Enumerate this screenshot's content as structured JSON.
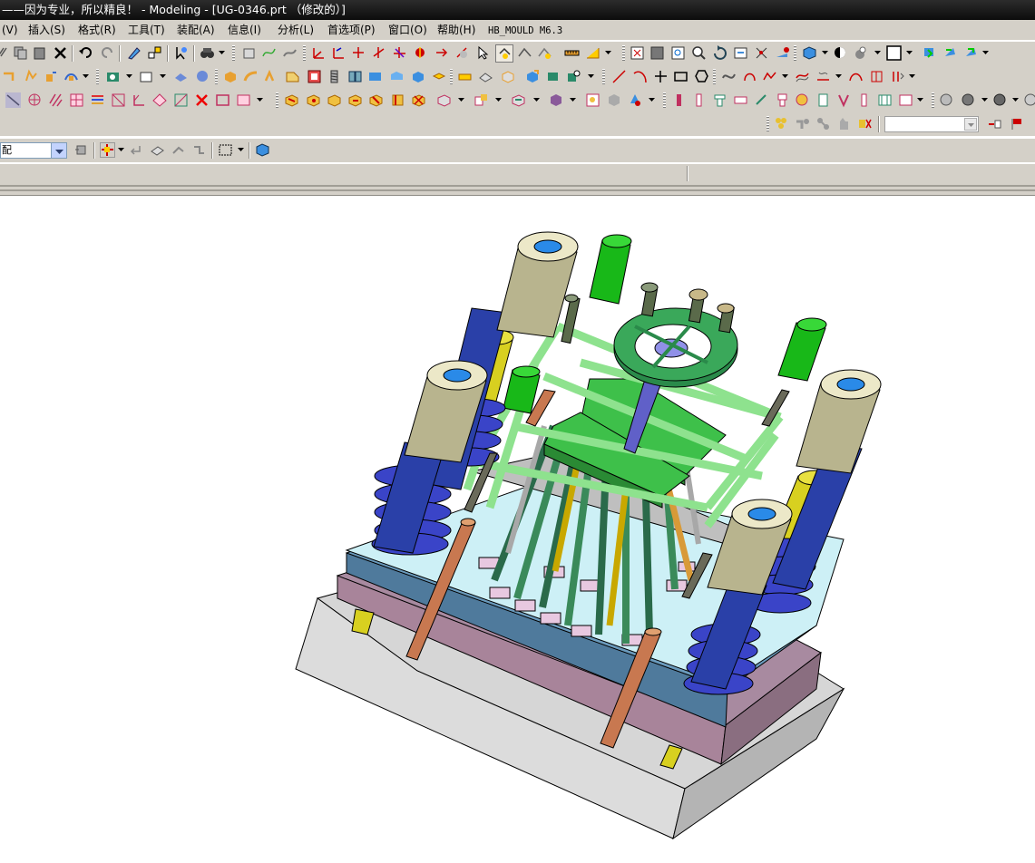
{
  "window": {
    "title": "——因为专业，所以精良！ - Modeling - [UG-0346.prt （修改的）]"
  },
  "menu": {
    "items": [
      {
        "key": "view",
        "label": "(V)"
      },
      {
        "key": "insert",
        "label": "插入(S)"
      },
      {
        "key": "format",
        "label": "格式(R)"
      },
      {
        "key": "tools",
        "label": "工具(T)"
      },
      {
        "key": "assembly",
        "label": "装配(A)"
      },
      {
        "key": "info",
        "label": "信息(I)"
      },
      {
        "key": "analysis",
        "label": "分析(L)"
      },
      {
        "key": "preferences",
        "label": "首选项(P)"
      },
      {
        "key": "window",
        "label": "窗口(O)"
      },
      {
        "key": "help",
        "label": "帮助(H)"
      },
      {
        "key": "hb-mould",
        "label": "HB_MOULD M6.3"
      }
    ]
  },
  "selection": {
    "filter_value": "配"
  },
  "colors": {
    "title_bg": "#1a1a1a",
    "chrome_bg": "#d4d0c8",
    "plate_gray": "#d6d6d6",
    "plate_purple": "#a8849a",
    "plate_blue": "#4f7a9c",
    "plate_cyan": "#c8eef4",
    "ejector_green": "#6fd46f",
    "handwheel_green": "#3a9e5a",
    "bushing_tan": "#b8b48e",
    "pillar_blue": "#2a40a8",
    "spring_blue": "#3a44c8",
    "pin_copper": "#c87850",
    "pin_yellow": "#d8d020"
  },
  "icons": {
    "toolbar_standard": [
      "cut-icon",
      "copy-icon",
      "paste-icon",
      "delete-icon",
      "undo-icon",
      "redo-icon",
      "edit-icon",
      "object-display-icon",
      "snap-icon",
      "binoculars-icon"
    ],
    "toolbar_view": [
      "fit-icon",
      "zoom-window-icon",
      "zoom-icon",
      "rotate-icon",
      "pan-icon",
      "orient-icon",
      "render-style-icon",
      "shading-icon",
      "background-icon",
      "layer-icon"
    ]
  }
}
